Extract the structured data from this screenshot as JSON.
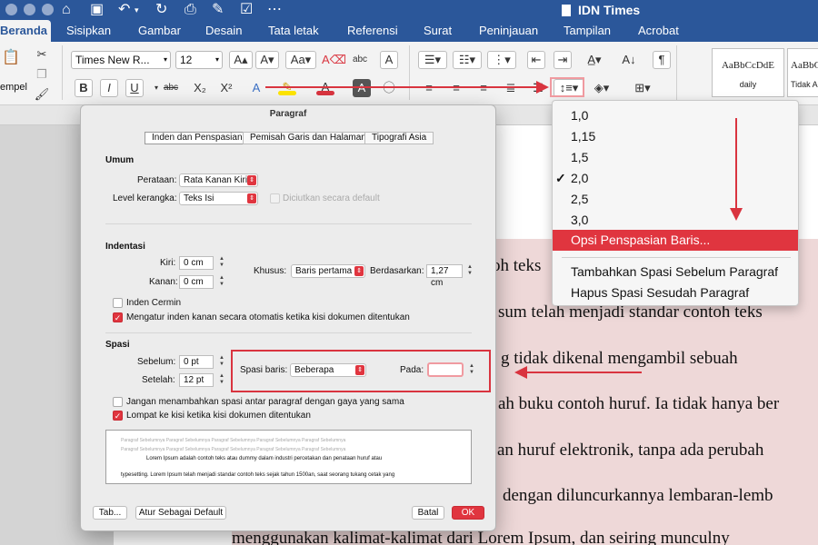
{
  "app": {
    "title": "IDN Times"
  },
  "tabs": [
    "Beranda",
    "Sisipkan",
    "Gambar",
    "Desain",
    "Tata letak",
    "Referensi",
    "Surat",
    "Peninjauan",
    "Tampilan",
    "Acrobat"
  ],
  "ribbon": {
    "font_name": "Times New R...",
    "font_size": "12",
    "paste_label": "empel",
    "styles": [
      {
        "sample": "AaBbCcDdE",
        "name": "daily"
      },
      {
        "sample": "AaBbC",
        "name": "Tidak A"
      }
    ]
  },
  "dropdown": {
    "items": [
      "1,0",
      "1,15",
      "1,5",
      "2,0",
      "2,5",
      "3,0"
    ],
    "check": "✓",
    "options_label": "Opsi Penspasian Baris...",
    "add_before": "Tambahkan Spasi Sebelum Paragraf",
    "remove_after": "Hapus Spasi Sesudah Paragraf"
  },
  "dialog": {
    "title": "Paragraf",
    "tabs": [
      "Inden dan Penspasian",
      "Pemisah Garis dan Halaman",
      "Tipografi Asia"
    ],
    "general": {
      "heading": "Umum",
      "alignment_label": "Perataan:",
      "alignment_value": "Rata Kanan Kiri",
      "outline_label": "Level kerangka:",
      "outline_value": "Teks Isi",
      "collapsed_label": "Diciutkan secara default"
    },
    "indentation": {
      "heading": "Indentasi",
      "left_label": "Kiri:",
      "left_value": "0 cm",
      "right_label": "Kanan:",
      "right_value": "0 cm",
      "special_label": "Khusus:",
      "special_value": "Baris pertama",
      "by_label": "Berdasarkan:",
      "by_value": "1,27 cm",
      "mirror_label": "Inden Cermin",
      "auto_label": "Mengatur inden kanan secara otomatis ketika kisi dokumen ditentukan"
    },
    "spacing": {
      "heading": "Spasi",
      "before_label": "Sebelum:",
      "before_value": "0 pt",
      "after_label": "Setelah:",
      "after_value": "12 pt",
      "line_label": "Spasi baris:",
      "line_value": "Beberapa",
      "at_label": "Pada:",
      "at_value": "",
      "dont_add_label": "Jangan menambahkan spasi antar paragraf dengan gaya yang sama",
      "snap_label": "Lompat ke kisi ketika kisi dokumen ditentukan"
    },
    "preview": {
      "gray_line": "Paragraf Sebelumnya Paragraf Sebelumnya Paragraf Sebelumnya Paragraf Sebelumnya Paragraf Sebelumnya",
      "line1": "Lorem Ipsum adalah contoh teks atau dummy dalam industri percetakan dan penataan huruf atau",
      "line2": "typesetting. Lorem Ipsum telah menjadi standar contoh teks sejak tahun 1500an, saat seorang tukang cetak yang"
    },
    "buttons": {
      "tabs": "Tab...",
      "default": "Atur Sebagai Default",
      "cancel": "Batal",
      "ok": "OK"
    }
  },
  "document": {
    "lines": [
      "oh teks",
      "sum telah menjadi standar contoh teks",
      "g tidak dikenal mengambil sebuah",
      "ah buku contoh huruf. Ia tidak hanya ber",
      "an huruf elektronik, tanpa ada perubah",
      "dengan diluncurkannya lembaran-lemb",
      "menggunakan kalimat-kalimat dari Lorem Ipsum, dan seiring munculny"
    ]
  }
}
